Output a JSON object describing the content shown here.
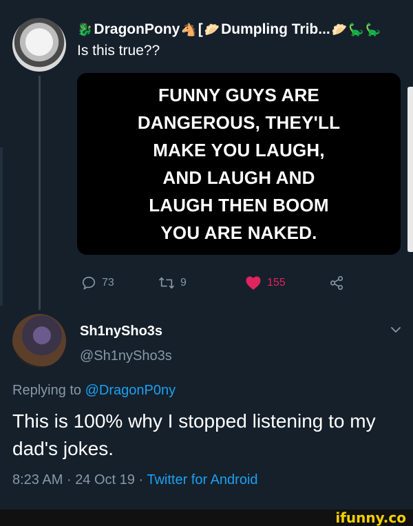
{
  "tweet": {
    "author_name_parts": [
      "DragonPony",
      "[",
      "Dumpling Trib..."
    ],
    "text": "Is this true??",
    "image_text": "FUNNY GUYS ARE\nDANGEROUS, THEY'LL\nMAKE YOU LAUGH,\nAND LAUGH AND\nLAUGH THEN BOOM\nYOU ARE NAKED.",
    "actions": {
      "reply_count": "73",
      "retweet_count": "9",
      "like_count": "155"
    }
  },
  "reply": {
    "name": "Sh1nySho3s",
    "handle": "@Sh1nySho3s",
    "replying_prefix": "Replying to",
    "replying_to": "@DragonP0ny",
    "text": "This is 100% why I stopped listening to my dad's jokes.",
    "time": "8:23 AM",
    "date": "24 Oct 19",
    "source": "Twitter for Android"
  },
  "watermark": "ifunny.co",
  "colors": {
    "background": "#15202b",
    "secondary_text": "#8899a6",
    "link": "#1da1f2",
    "like": "#e0245e",
    "watermark": "#f5d000"
  },
  "icons": [
    "emoji-dragon-icon",
    "emoji-pony-icon",
    "emoji-dumpling-icon",
    "reply-icon",
    "retweet-icon",
    "heart-icon",
    "share-icon",
    "chevron-down-icon"
  ]
}
